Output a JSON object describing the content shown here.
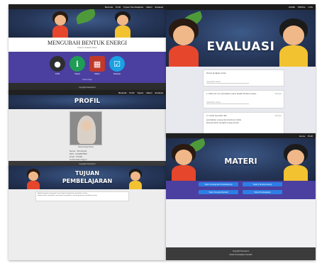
{
  "home": {
    "nav": [
      "Beranda",
      "Profil",
      "Tujuan Pembelajaran",
      "Materi",
      "Evaluasi"
    ],
    "title": "MENGUBAH BENTUK ENERGI",
    "subtitle": "Kelas IV Sekolah Dasar",
    "menu": [
      {
        "label": "Profil",
        "icon": "person-icon",
        "color": "#2e2e2e"
      },
      {
        "label": "Tujuan",
        "icon": "info-icon",
        "color": "#1f9d55"
      },
      {
        "label": "Materi",
        "icon": "books-icon",
        "color": "#c0392b"
      },
      {
        "label": "Evaluasi",
        "icon": "checklist-icon",
        "color": "#1ba1e2"
      }
    ],
    "extra": "Mulai belajar",
    "footer": "Copyright Kelompok 4"
  },
  "evaluasi": {
    "nav": [
      "HOME",
      "PROFIL",
      "LOG"
    ],
    "title": "EVALUASI",
    "q1_label": "Nama lengkap siswa",
    "q1_placeholder": "Jawaban Anda",
    "q2": "1. Menurut mu perubahan yang terjadi berikut energi...",
    "q2_points": "10 poin",
    "q3_title": "2. Listrik berubah dari",
    "q3_lines": [
      "perubahan energi dari kimia ke listrik",
      "Energi listrik menjadi energi panas"
    ],
    "q3_points": "10 poin"
  },
  "profil": {
    "nav": [
      "Beranda",
      "Profil",
      "Tujuan",
      "Materi",
      "Evaluasi"
    ],
    "title": "PROFIL",
    "caption": "Nama Pengembang",
    "info": [
      "Nama : Siti Aisyah",
      "NIM : 1234567890",
      "Prodi : PGSD",
      "Universitas Negeri",
      "Email : siti@mail.com"
    ],
    "footer": "Copyright Kelompok 4"
  },
  "tujuan": {
    "title_line1": "TUJUAN",
    "title_line2": "PEMBELAJARAN",
    "items": [
      "Melalui kegiatan mengamati siswa dapat menjelaskan perubahan energi",
      "Melalui diskusi kelompok siswa dapat menyajikan hasil pengamatan perubahan energi"
    ]
  },
  "materi": {
    "nav": [
      "Home",
      "Profil"
    ],
    "title": "MATERI",
    "buttons": [
      "Topik 1 Energi dan Perubahannya",
      "Topik 2 Sumber Energi",
      "Topik 3 Energi Alternatif",
      "Video Pembelajaran"
    ],
    "footer_line1": "Copyright Kelompok 4",
    "footer_line2": "Media Pembelajaran Interaktif"
  }
}
